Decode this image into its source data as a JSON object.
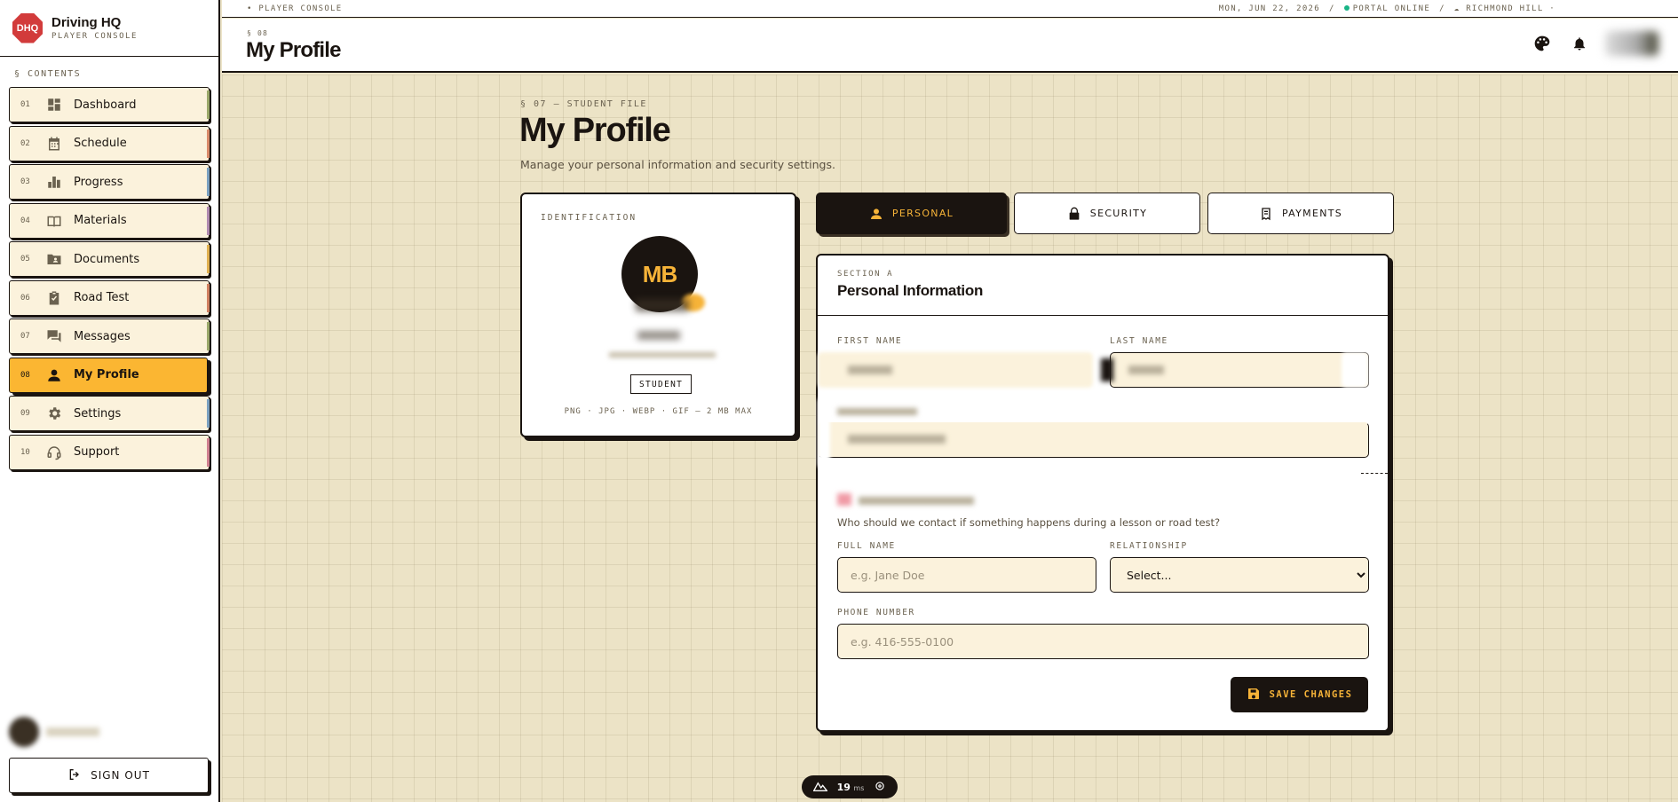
{
  "brand": {
    "logo": "DHQ",
    "title": "Driving HQ",
    "subtitle": "PLAYER CONSOLE"
  },
  "sidebar": {
    "contents_label": "§ CONTENTS",
    "items": [
      {
        "num": "01",
        "label": "Dashboard",
        "icon": "dashboard-icon",
        "accent": "#9aa86a"
      },
      {
        "num": "02",
        "label": "Schedule",
        "icon": "calendar-icon",
        "accent": "#d98a6a"
      },
      {
        "num": "03",
        "label": "Progress",
        "icon": "bar-chart-icon",
        "accent": "#7aa0c0"
      },
      {
        "num": "04",
        "label": "Materials",
        "icon": "book-icon",
        "accent": "#b08ab0"
      },
      {
        "num": "05",
        "label": "Documents",
        "icon": "folder-user-icon",
        "accent": "#e0b050"
      },
      {
        "num": "06",
        "label": "Road Test",
        "icon": "clipboard-check-icon",
        "accent": "#d08060"
      },
      {
        "num": "07",
        "label": "Messages",
        "icon": "chat-icon",
        "accent": "#9aa86a"
      },
      {
        "num": "08",
        "label": "My Profile",
        "icon": "user-icon",
        "accent": "#1a1410"
      },
      {
        "num": "09",
        "label": "Settings",
        "icon": "gear-icon",
        "accent": "#7aa0c0"
      },
      {
        "num": "10",
        "label": "Support",
        "icon": "headset-icon",
        "accent": "#d08090"
      }
    ],
    "active_index": 7,
    "signout_label": "SIGN OUT"
  },
  "ticker": {
    "left": "• PLAYER CONSOLE",
    "date": "MON, JUN 22, 2026",
    "sep": "/",
    "status": "PORTAL ONLINE",
    "location": "RICHMOND HILL ·"
  },
  "header": {
    "crumb": "§ 08",
    "title": "My Profile"
  },
  "page": {
    "eyebrow": "§ 07 — STUDENT FILE",
    "title": "My Profile",
    "description": "Manage your personal information and security settings."
  },
  "id_card": {
    "label": "IDENTIFICATION",
    "initials": "MB",
    "badge": "STUDENT",
    "formats": "PNG · JPG · WEBP · GIF — 2 MB MAX"
  },
  "tabs": [
    {
      "label": "PERSONAL",
      "icon": "user-icon",
      "active": true
    },
    {
      "label": "SECURITY",
      "icon": "lock-icon",
      "active": false
    },
    {
      "label": "PAYMENTS",
      "icon": "receipt-icon",
      "active": false
    }
  ],
  "form": {
    "section": "SECTION A",
    "title": "Personal Information",
    "first_name_label": "FIRST NAME",
    "last_name_label": "LAST NAME",
    "emergency_helper": "Who should we contact if something happens during a lesson or road test?",
    "full_name_label": "FULL NAME",
    "full_name_placeholder": "e.g. Jane Doe",
    "relationship_label": "RELATIONSHIP",
    "relationship_value": "Select...",
    "phone_label": "PHONE NUMBER",
    "phone_placeholder": "e.g. 416-555-0100",
    "save_label": "SAVE CHANGES"
  },
  "perf": {
    "value": "19",
    "unit": "ms"
  },
  "colors": {
    "accent": "#fbb632",
    "ink": "#1a1410",
    "paper": "#fbf2dc",
    "online": "#19b486"
  }
}
